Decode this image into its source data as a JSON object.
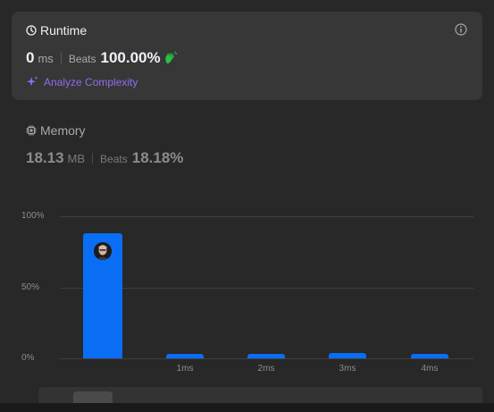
{
  "runtime": {
    "title": "Runtime",
    "value": "0",
    "unit": "ms",
    "beats_label": "Beats",
    "beats_value": "100.00%",
    "analyze_label": "Analyze Complexity"
  },
  "memory": {
    "title": "Memory",
    "value": "18.13",
    "unit": "MB",
    "beats_label": "Beats",
    "beats_value": "18.18%"
  },
  "colors": {
    "bar": "#0a6ef5",
    "analyze": "#8e6df0",
    "clap": "#28c244"
  },
  "icons": {
    "runtime": "clock-icon",
    "memory": "chip-icon",
    "info": "info-icon",
    "analyze": "sparkle-icon",
    "beats": "clap-icon",
    "marker": "avatar"
  },
  "chart_data": {
    "type": "bar",
    "categories": [
      "",
      "1ms",
      "2ms",
      "3ms",
      "4ms"
    ],
    "values": [
      88,
      3,
      3,
      4,
      3
    ],
    "yticks": [
      "100%",
      "50%",
      "0%"
    ],
    "ylim": [
      0,
      100
    ],
    "highlight_index": 0,
    "grid": true
  }
}
